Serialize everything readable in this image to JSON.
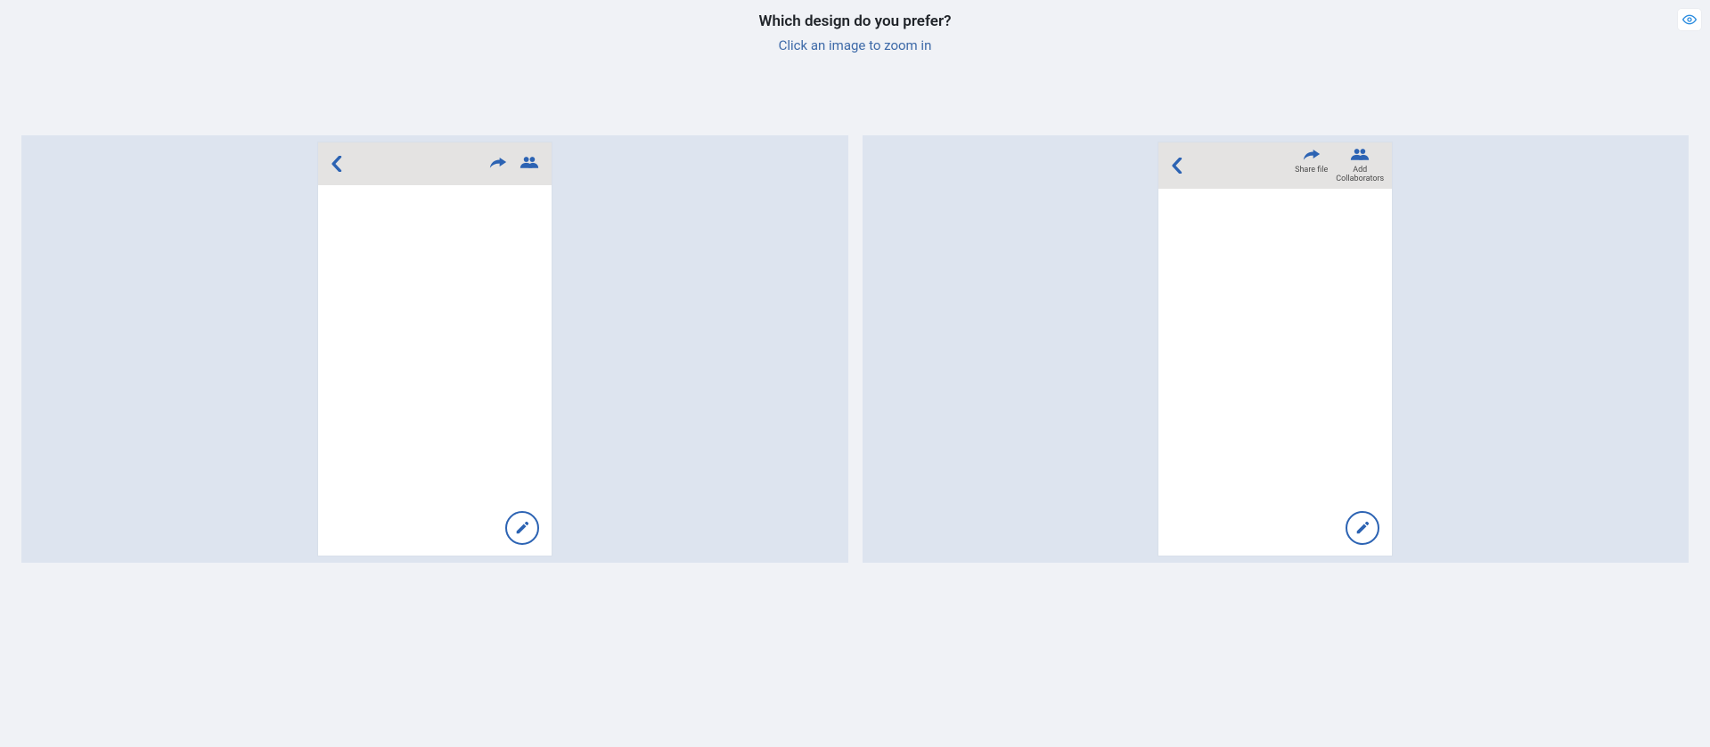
{
  "header": {
    "title": "Which design do you prefer?",
    "subtitle": "Click an image to zoom in"
  },
  "toolbar": {
    "visibility_icon": "eye-icon"
  },
  "options": {
    "a": {
      "back_icon": "chevron-left-icon",
      "share_icon": "share-icon",
      "collab_icon": "group-icon",
      "fab_icon": "pencil-icon"
    },
    "b": {
      "back_icon": "chevron-left-icon",
      "share": {
        "icon": "share-icon",
        "label": "Share file"
      },
      "collab": {
        "icon": "group-icon",
        "label": "Add Collaborators"
      },
      "fab_icon": "pencil-icon"
    }
  }
}
